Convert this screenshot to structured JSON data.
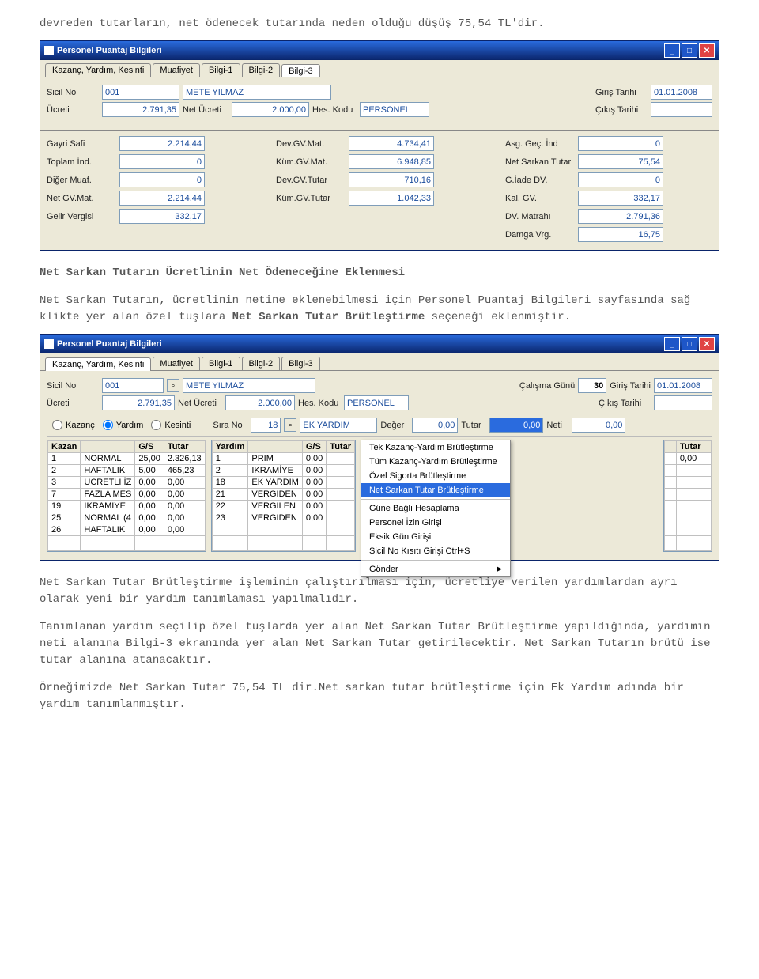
{
  "intro": "devreden tutarların, net ödenecek tutarında neden olduğu düşüş 75,54 TL'dir.",
  "win1": {
    "title": "Personel Puantaj Bilgileri",
    "tabs": [
      "Kazanç, Yardım, Kesinti",
      "Muafiyet",
      "Bilgi-1",
      "Bilgi-2",
      "Bilgi-3"
    ],
    "activeTab": 4,
    "sicil_lbl": "Sicil No",
    "sicil": "001",
    "name": "METE YILMAZ",
    "giris_lbl": "Giriş Tarihi",
    "giris": "01.01.2008",
    "ucreti_lbl": "Ücreti",
    "ucreti": "2.791,35",
    "netucr_lbl": "Net Ücreti",
    "netucr": "2.000,00",
    "hes_lbl": "Hes. Kodu",
    "hes": "PERSONEL",
    "cikis_lbl": "Çıkış Tarihi",
    "cikis": "",
    "grid": [
      [
        "Gayri Safi",
        "2.214,44",
        "Dev.GV.Mat.",
        "4.734,41",
        "Asg. Geç. İnd",
        "0"
      ],
      [
        "Toplam İnd.",
        "0",
        "Küm.GV.Mat.",
        "6.948,85",
        "Net Sarkan Tutar",
        "75,54"
      ],
      [
        "Diğer Muaf.",
        "0",
        "Dev.GV.Tutar",
        "710,16",
        "G.İade DV.",
        "0"
      ],
      [
        "Net GV.Mat.",
        "2.214,44",
        "Küm.GV.Tutar",
        "1.042,33",
        "Kal. GV.",
        "332,17"
      ],
      [
        "Gelir Vergisi",
        "332,17",
        "",
        "",
        "DV. Matrahı",
        "2.791,36"
      ],
      [
        "",
        "",
        "",
        "",
        "Damga Vrg.",
        "16,75"
      ]
    ]
  },
  "mid": {
    "h": "Net Sarkan Tutarın Ücretlinin Net Ödeneceğine Eklenmesi",
    "p": "Net Sarkan Tutarın, ücretlinin netine eklenebilmesi için Personel Puantaj Bilgileri sayfasında sağ klikte yer alan özel tuşlara ",
    "pb": "Net Sarkan Tutar Brütleştirme",
    "p2": " seçeneği eklenmiştir."
  },
  "win2": {
    "title": "Personel Puantaj Bilgileri",
    "tabs": [
      "Kazanç, Yardım, Kesinti",
      "Muafiyet",
      "Bilgi-1",
      "Bilgi-2",
      "Bilgi-3"
    ],
    "activeTab": 0,
    "sicil_lbl": "Sicil No",
    "sicil": "001",
    "name": "METE YILMAZ",
    "calisma_lbl": "Çalışma Günü",
    "calisma": "30",
    "giris_lbl": "Giriş Tarihi",
    "giris": "01.01.2008",
    "ucreti_lbl": "Ücreti",
    "ucreti": "2.791,35",
    "netucr_lbl": "Net Ücreti",
    "netucr": "2.000,00",
    "hes_lbl": "Hes. Kodu",
    "hes": "PERSONEL",
    "cikis_lbl": "Çıkış Tarihi",
    "cikis": "",
    "radios": [
      "Kazanç",
      "Yardım",
      "Kesinti"
    ],
    "sirano_lbl": "Sıra No",
    "sirano": "18",
    "sira_name": "EK YARDIM",
    "deger_lbl": "Değer",
    "deger": "0,00",
    "tutar_lbl": "Tutar",
    "tutar": "0,00",
    "neti_lbl": "Neti",
    "neti": "0,00",
    "t1": {
      "head": [
        "Kazan",
        "",
        "G/S",
        "Tutar"
      ],
      "rows": [
        [
          "1",
          "NORMAL",
          "25,00",
          "2.326,13"
        ],
        [
          "2",
          "HAFTALIK",
          "5,00",
          "465,23"
        ],
        [
          "3",
          "UCRETLI İZ",
          "0,00",
          "0,00"
        ],
        [
          "7",
          "FAZLA MES",
          "0,00",
          "0,00"
        ],
        [
          "19",
          "IKRAMIYE",
          "0,00",
          "0,00"
        ],
        [
          "25",
          "NORMAL (4",
          "0,00",
          "0,00"
        ],
        [
          "26",
          "HAFTALIK",
          "0,00",
          "0,00"
        ]
      ]
    },
    "t2": {
      "head": [
        "Yardım",
        "",
        "G/S",
        "Tutar"
      ],
      "rows": [
        [
          "1",
          "PRIM",
          "0,00",
          ""
        ],
        [
          "2",
          "IKRAMİYE",
          "0,00",
          ""
        ],
        [
          "18",
          "EK YARDIM",
          "0,00",
          ""
        ],
        [
          "21",
          "VERGIDEN",
          "0,00",
          ""
        ],
        [
          "22",
          "VERGILEN",
          "0,00",
          ""
        ],
        [
          "23",
          "VERGIDEN",
          "0,00",
          ""
        ]
      ]
    },
    "t3": {
      "head": [
        "",
        "Tutar"
      ],
      "rows": [
        [
          "",
          "0,00"
        ]
      ]
    },
    "ctx": [
      "Tek Kazanç-Yardım Brütleştirme",
      "Tüm Kazanç-Yardım Brütleştirme",
      "Özel Sigorta Brütleştirme",
      "Net Sarkan Tutar Brütleştirme",
      "Güne Bağlı Hesaplama",
      "Personel İzin Girişi",
      "Eksik Gün Girişi",
      "Sicil No Kısıtı Girişi Ctrl+S",
      "Gönder"
    ],
    "ctxSel": 3
  },
  "out": {
    "p1": "Net Sarkan Tutar Brütleştirme işleminin çalıştırılması için, ücretliye verilen yardımlardan ayrı olarak yeni bir yardım tanımlaması yapılmalıdır.",
    "p2": "Tanımlanan yardım seçilip özel tuşlarda yer alan Net Sarkan Tutar Brütleştirme yapıldığında, yardımın neti alanına Bilgi-3 ekranında yer alan Net Sarkan Tutar getirilecektir. Net Sarkan Tutarın brütü ise tutar alanına atanacaktır.",
    "p3": "Örneğimizde Net Sarkan Tutar 75,54 TL dir.Net sarkan tutar brütleştirme için Ek Yardım adında bir yardım tanımlanmıştır."
  }
}
